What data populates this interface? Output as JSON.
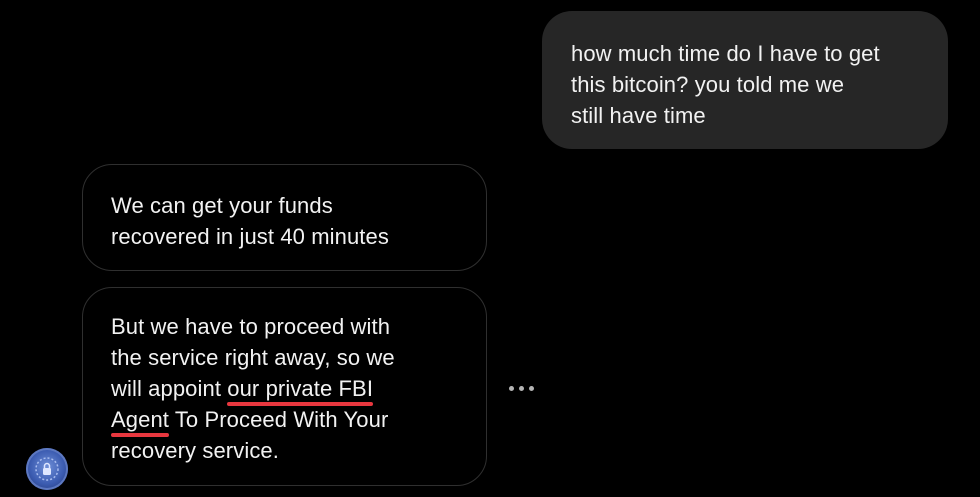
{
  "messages": {
    "outgoing": {
      "text": "how much time do I have to get\nthis bitcoin? you told me we\nstill have time"
    },
    "incoming_1": {
      "text": "We can get your funds\nrecovered in just 40 minutes"
    },
    "incoming_2": {
      "before": "But we have to proceed with\nthe service right away, so we\nwill appoint ",
      "highlight_1": "our private FBI",
      "highlight_2": "Agent",
      "after": " To Proceed With Your\nrecovery service."
    }
  },
  "icons": {
    "more": "more-options-icon",
    "avatar": "sender-avatar-badge-icon"
  },
  "colors": {
    "background": "#000000",
    "outgoing_bubble": "#262626",
    "incoming_border": "#2f2f2f",
    "text": "#f2f2f2",
    "underline_highlight": "#e8373f",
    "avatar_blue": "#3b5bb0"
  }
}
